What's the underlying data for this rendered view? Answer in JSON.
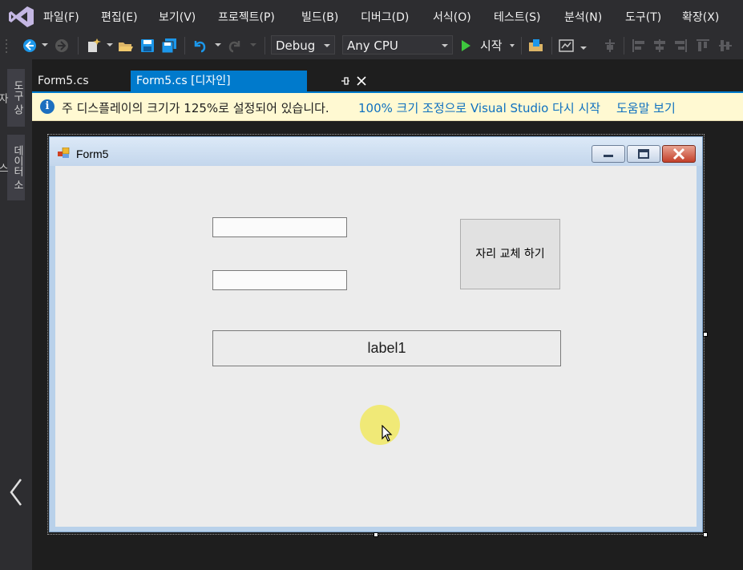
{
  "menu": {
    "items": [
      "파일(F)",
      "편집(E)",
      "보기(V)",
      "프로젝트(P)",
      "빌드(B)",
      "디버그(D)",
      "서식(O)",
      "테스트(S)",
      "분석(N)",
      "도구(T)",
      "확장(X)"
    ]
  },
  "toolbar": {
    "config_value": "Debug",
    "platform_value": "Any CPU",
    "start_label": "시작"
  },
  "side": {
    "toolbox_label": "도구 상자",
    "datasource_label": "데이터 소스"
  },
  "tabs": [
    {
      "label": "Form5.cs",
      "active": false
    },
    {
      "label": "Form5.cs [디자인]",
      "active": true
    }
  ],
  "infobar": {
    "message": "주 디스플레이의 크기가 125%로 설정되어 있습니다.",
    "restart_link": "100% 크기 조정으로 Visual Studio 다시 시작",
    "help_link": "도움말 보기"
  },
  "form": {
    "title": "Form5",
    "button_label": "자리 교체 하기",
    "label_text": "label1",
    "textbox1_value": "",
    "textbox2_value": ""
  },
  "colors": {
    "accent": "#007acc",
    "infobar_bg": "#fff9d2",
    "link": "#0e70c0",
    "cursor_halo": "#f1e96a"
  }
}
